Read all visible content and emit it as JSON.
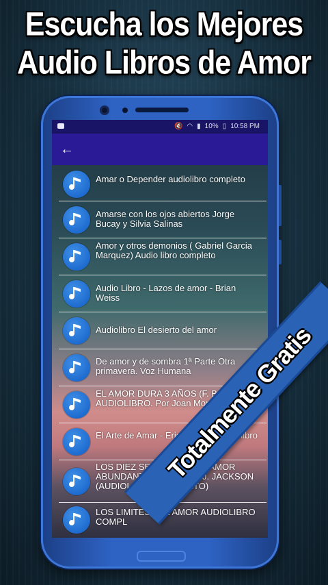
{
  "banner": {
    "line1": "Escucha los Mejores",
    "line2": "Audio Libros de Amor"
  },
  "statusbar": {
    "battery": "10%",
    "time": "10:58 PM",
    "icons": [
      "youtube-icon",
      "mute-icon",
      "wifi-icon",
      "signal-icon",
      "battery-icon"
    ]
  },
  "appbar": {
    "back_icon": "arrow-left-icon"
  },
  "list": {
    "items": [
      {
        "title": "Amar o Depender audiolibro completo"
      },
      {
        "title": "Amarse con los ojos abiertos Jorge Bucay y Silvia Salinas"
      },
      {
        "title": "Amor y otros demonios ( Gabriel Garcia Marquez) Audio libro completo"
      },
      {
        "title": "Audio Libro - Lazos de amor - Brian Weiss"
      },
      {
        "title": "Audiolibro El desierto del amor"
      },
      {
        "title": "De amor y de sombra 1ª Parte Otra primavera. Voz Humana"
      },
      {
        "title": "EL AMOR DURA 3 AÑOS (F. Beigbeder) AUDIOLIBRO. Por Joan Mora"
      },
      {
        "title": "El Arte de Amar - Erich Fromm Audiolibro"
      },
      {
        "title": "LOS DIEZ SECRETOS DEL AMOR ABUNDANTE POR ADAM J. JACKSON (AUDIOLIBRO COMPLETO)"
      },
      {
        "title": "LOS LIMITES DEL AMOR AUDIOLIBRO COMPL"
      }
    ],
    "item_icon": "music-note-icon",
    "icon_color": "#1f6cd0"
  },
  "ribbon": {
    "label": "Totalmente Gratis"
  },
  "colors": {
    "statusbar": "#1a1466",
    "appbar": "#2a1a96",
    "phone_frame": "#2e63c4"
  }
}
